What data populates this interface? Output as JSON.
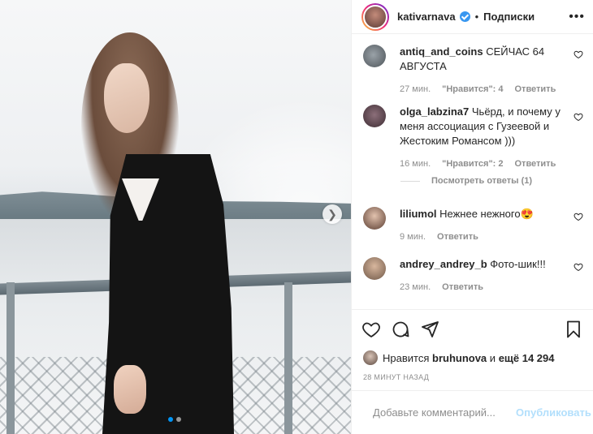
{
  "post": {
    "username": "kativarnava",
    "verified": true,
    "separator": "•",
    "follow_label": "Подписки",
    "more_icon": "more-horizontal-icon"
  },
  "comments": [
    {
      "user": "antiq_and_coins",
      "text": "СЕЙЧАС 64 АВГУСТА",
      "time": "27 мин.",
      "likes": "\"Нравится\": 4",
      "reply": "Ответить"
    },
    {
      "user": "olga_labzina7",
      "text": "Чьёрд, и почему у меня ассоциация с Гузеевой и Жестоким Романсом )))",
      "time": "16 мин.",
      "likes": "\"Нравится\": 2",
      "reply": "Ответить"
    },
    {
      "user": "liliumol",
      "text": "Нежнее нежного",
      "emoji": "😍",
      "time": "9 мин.",
      "reply": "Ответить"
    },
    {
      "user": "andrey_andrey_b",
      "text": "Фото-шик!!!",
      "time": "23 мин.",
      "reply": "Ответить"
    }
  ],
  "view_replies_label": "Посмотреть ответы (1)",
  "likes": {
    "prefix": "Нравится",
    "user": "bruhunova",
    "middle": "и",
    "count": "ещё 14 294"
  },
  "timestamp": "28 МИНУТ НАЗАД",
  "add_comment": {
    "placeholder": "Добавьте комментарий...",
    "publish_label": "Опубликовать"
  },
  "carousel": {
    "slides": 2,
    "active": 1
  },
  "colors": {
    "accent": "#0095f6",
    "verified": "#3897f0",
    "publish_disabled": "#b2dffc",
    "muted": "#8e8e8e"
  }
}
